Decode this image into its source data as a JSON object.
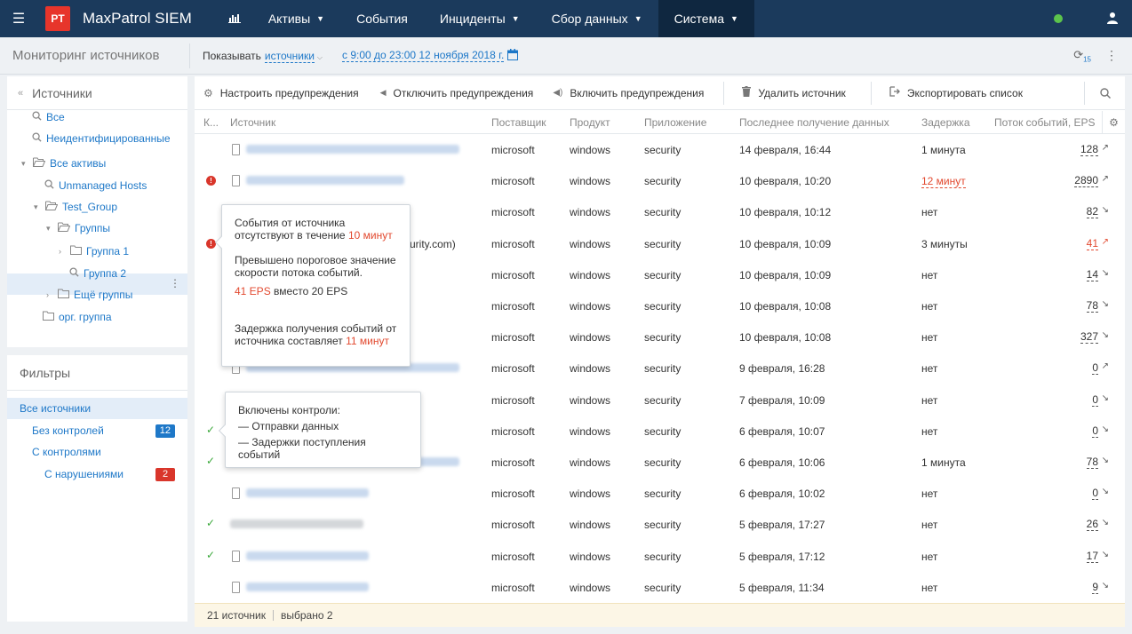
{
  "topnav": {
    "logo": "PT",
    "app_name": "MaxPatrol SIEM",
    "items": [
      {
        "label": "Активы",
        "has_menu": true
      },
      {
        "label": "События",
        "has_menu": false
      },
      {
        "label": "Инциденты",
        "has_menu": true
      },
      {
        "label": "Сбор данных",
        "has_menu": true
      },
      {
        "label": "Система",
        "has_menu": true,
        "active": true
      }
    ]
  },
  "subheader": {
    "title": "Мониторинг источников",
    "show_label": "Показывать",
    "show_value": "источники",
    "range": "с 9:00 до 23:00 12 ноября 2018 г.",
    "refresh_badge": "15"
  },
  "sources_panel": {
    "title": "Источники",
    "tree": [
      {
        "label": "Все",
        "icon": "search-icon"
      },
      {
        "label": "Неидентифицированные",
        "icon": "search-icon"
      },
      {
        "label": "Все активы",
        "icon": "folder-open-icon"
      },
      {
        "label": "Unmanaged Hosts",
        "icon": "search-icon"
      },
      {
        "label": "Test_Group",
        "icon": "folder-open-icon"
      },
      {
        "label": "Группы",
        "icon": "folder-open-icon"
      },
      {
        "label": "Группа 1",
        "icon": "folder-icon"
      },
      {
        "label": "Группа 2",
        "icon": "search-icon",
        "selected": true
      },
      {
        "label": "Ещё группы",
        "icon": "folder-icon"
      },
      {
        "label": "орг. группа",
        "icon": "folder-icon"
      }
    ]
  },
  "filters_panel": {
    "title": "Фильтры",
    "items": [
      {
        "label": "Все источники",
        "selected": true
      },
      {
        "label": "Без контролей",
        "count": "12",
        "color": "#1e78c8"
      },
      {
        "label": "С контролями"
      },
      {
        "label": "С нарушениями",
        "count": "2",
        "color": "#d9362b"
      }
    ]
  },
  "toolbar": {
    "configure": "Настроить предупреждения",
    "disable": "Отключить предупреждения",
    "enable": "Включить предупреждения",
    "delete": "Удалить источник",
    "export": "Экспортировать список"
  },
  "table": {
    "columns": {
      "k": "К...",
      "source": "Источник",
      "vendor": "Поставщик",
      "product": "Продукт",
      "app": "Приложение",
      "last": "Последнее получение данных",
      "delay": "Задержка",
      "eps": "Поток событий, EPS"
    },
    "rows": [
      {
        "status": "",
        "source_visible": "",
        "vendor": "microsoft",
        "product": "windows",
        "app": "security",
        "last": "14 февраля, 16:44",
        "delay": "1 минута",
        "delay_alert": false,
        "eps": "128",
        "eps_alert": false,
        "trend": "up"
      },
      {
        "status": "error",
        "source_visible": "",
        "vendor": "microsoft",
        "product": "windows",
        "app": "security",
        "last": "10 февраля, 10:20",
        "delay": "12 минут",
        "delay_alert": true,
        "eps": "2890",
        "eps_alert": false,
        "trend": "up"
      },
      {
        "status": "",
        "source_visible": "",
        "vendor": "microsoft",
        "product": "windows",
        "app": "security",
        "last": "10 февраля, 10:12",
        "delay": "нет",
        "delay_alert": false,
        "eps": "82",
        "eps_alert": false,
        "trend": "down"
      },
      {
        "status": "error",
        "source_visible": "curity.com)",
        "vendor": "microsoft",
        "product": "windows",
        "app": "security",
        "last": "10 февраля, 10:09",
        "delay": "3 минуты",
        "delay_alert": false,
        "eps": "41",
        "eps_alert": true,
        "trend": "up"
      },
      {
        "status": "",
        "source_visible": "",
        "vendor": "microsoft",
        "product": "windows",
        "app": "security",
        "last": "10 февраля, 10:09",
        "delay": "нет",
        "delay_alert": false,
        "eps": "14",
        "eps_alert": false,
        "trend": "down"
      },
      {
        "status": "",
        "source_visible": "",
        "vendor": "microsoft",
        "product": "windows",
        "app": "security",
        "last": "10 февраля, 10:08",
        "delay": "нет",
        "delay_alert": false,
        "eps": "78",
        "eps_alert": false,
        "trend": "down"
      },
      {
        "status": "",
        "source_visible": "",
        "vendor": "microsoft",
        "product": "windows",
        "app": "security",
        "last": "10 февраля, 10:08",
        "delay": "нет",
        "delay_alert": false,
        "eps": "327",
        "eps_alert": false,
        "trend": "down"
      },
      {
        "status": "",
        "source_visible": "",
        "vendor": "microsoft",
        "product": "windows",
        "app": "security",
        "last": "9 февраля, 16:28",
        "delay": "нет",
        "delay_alert": false,
        "eps": "0",
        "eps_alert": false,
        "trend": "up"
      },
      {
        "status": "",
        "source_visible": "",
        "vendor": "microsoft",
        "product": "windows",
        "app": "security",
        "last": "7 февраля, 10:09",
        "delay": "нет",
        "delay_alert": false,
        "eps": "0",
        "eps_alert": false,
        "trend": "down"
      },
      {
        "status": "ok",
        "source_visible": "",
        "vendor": "microsoft",
        "product": "windows",
        "app": "security",
        "last": "6 февраля, 10:07",
        "delay": "нет",
        "delay_alert": false,
        "eps": "0",
        "eps_alert": false,
        "trend": "down"
      },
      {
        "status": "ok",
        "source_visible": "",
        "vendor": "microsoft",
        "product": "windows",
        "app": "security",
        "last": "6 февраля, 10:06",
        "delay": "1 минута",
        "delay_alert": false,
        "eps": "78",
        "eps_alert": false,
        "trend": "down"
      },
      {
        "status": "",
        "source_visible": "",
        "vendor": "microsoft",
        "product": "windows",
        "app": "security",
        "last": "6 февраля, 10:02",
        "delay": "нет",
        "delay_alert": false,
        "eps": "0",
        "eps_alert": false,
        "trend": "down"
      },
      {
        "status": "ok",
        "source_visible": "",
        "vendor": "microsoft",
        "product": "windows",
        "app": "security",
        "last": "5 февраля, 17:27",
        "delay": "нет",
        "delay_alert": false,
        "eps": "26",
        "eps_alert": false,
        "trend": "down"
      },
      {
        "status": "ok",
        "source_visible": "",
        "vendor": "microsoft",
        "product": "windows",
        "app": "security",
        "last": "5 февраля, 17:12",
        "delay": "нет",
        "delay_alert": false,
        "eps": "17",
        "eps_alert": false,
        "trend": "down"
      },
      {
        "status": "",
        "source_visible": "",
        "vendor": "microsoft",
        "product": "windows",
        "app": "security",
        "last": "5 февраля, 11:34",
        "delay": "нет",
        "delay_alert": false,
        "eps": "9",
        "eps_alert": false,
        "trend": "down"
      }
    ]
  },
  "footer": {
    "count": "21 источник",
    "selected": "выбрано 2"
  },
  "tooltip_alerts": {
    "line1": "События от источника",
    "line2_prefix": "отсутствуют в течение",
    "line2_value": "10 минут",
    "line3": "Превышено пороговое значение",
    "line4": "скорости потока событий.",
    "eps_value": "41 EPS",
    "eps_suffix": "вместо 20 EPS",
    "line5": "Задержка получения событий от",
    "line6_prefix": "источника составляет",
    "line6_value": "11 минут"
  },
  "tooltip_controls": {
    "title": "Включены контроли:",
    "item1": "— Отправки данных",
    "item2": "— Задержки поступления событий"
  }
}
